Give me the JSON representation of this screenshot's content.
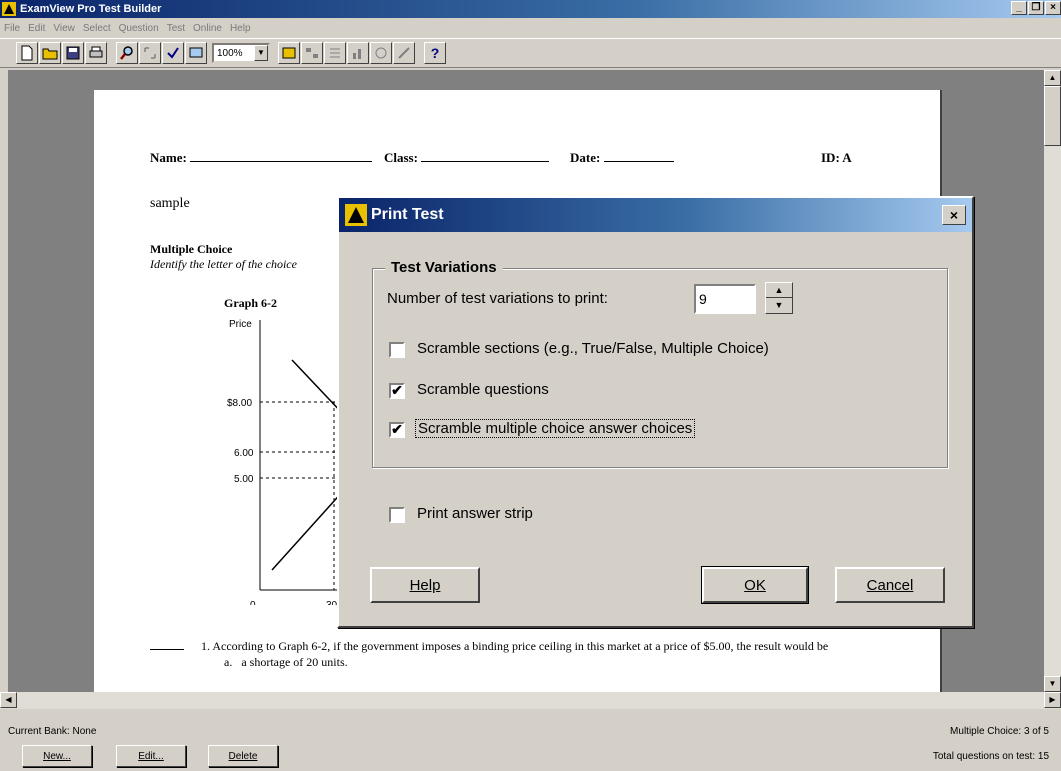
{
  "window": {
    "title": "ExamView Pro Test Builder",
    "controls": [
      "_",
      "&#x25A1;",
      "×"
    ]
  },
  "menu": [
    "File",
    "Edit",
    "View",
    "Select",
    "Question",
    "Test",
    "Online",
    "Help"
  ],
  "toolbar": {
    "zoom": "100%",
    "help_label": "?"
  },
  "page": {
    "name_label": "Name:",
    "class_label": "Class:",
    "date_label": "Date:",
    "id_label": "ID: A",
    "title": "sample",
    "section_title": "Multiple Choice",
    "instructions": "Identify the letter of the choice",
    "graph": {
      "title": "Graph 6-2",
      "y_axis_label": "Price",
      "y_ticks": [
        "$8.00",
        "6.00",
        "5.00",
        "0"
      ],
      "x_ticks": [
        "30"
      ]
    },
    "question": {
      "number": "1.",
      "text": "According to Graph 6-2, if the government imposes a binding price ceiling in this market at a price of $5.00, the result would be",
      "option_a_letter": "a.",
      "option_a_text": "a shortage of 20 units."
    }
  },
  "dialog": {
    "title": "Print Test",
    "close": "×",
    "group_title": "Test Variations",
    "variations_label": "Number of test variations to print:",
    "variations_value": "9",
    "scramble_sections": {
      "label": "Scramble sections (e.g., True/False, Multiple Choice)",
      "checked": false
    },
    "scramble_questions": {
      "label": "Scramble questions",
      "checked": true
    },
    "scramble_choices": {
      "label": "Scramble multiple choice answer choices",
      "checked": true
    },
    "answer_strip": {
      "label": "Print answer strip",
      "checked": false
    },
    "help_button": "Help",
    "ok_button": "OK",
    "cancel_button": "Cancel",
    "check_mark": "✔"
  },
  "status": {
    "current_bank": "Current Bank: None",
    "mc_count": "Multiple Choice: 3 of 5",
    "total": "Total questions on test: 15",
    "new_button": "New...",
    "edit_button": "Edit...",
    "delete_button": "Delete"
  }
}
